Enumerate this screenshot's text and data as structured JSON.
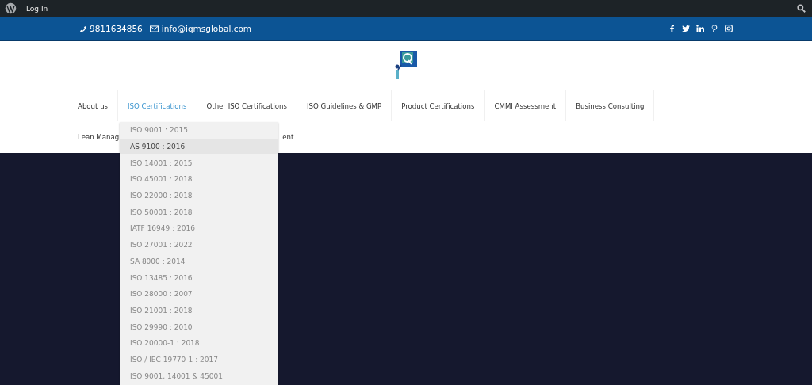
{
  "admin_bar": {
    "login": "Log In"
  },
  "top_bar": {
    "phone": "9811634856",
    "email": "info@iqmsglobal.com"
  },
  "nav": {
    "row_1": [
      {
        "label": "About us",
        "selected": false
      },
      {
        "label": "ISO Certifications",
        "selected": true
      },
      {
        "label": "Other ISO Certifications",
        "selected": false
      },
      {
        "label": "ISO Guidelines & GMP",
        "selected": false
      },
      {
        "label": "Product Certifications",
        "selected": false
      },
      {
        "label": "CMMI Assessment",
        "selected": false
      },
      {
        "label": "Business Consulting",
        "selected": false
      }
    ],
    "row_2": [
      "Lean Manag",
      "ent"
    ]
  },
  "dropdown": [
    {
      "label": "ISO 9001 : 2015",
      "selected": false
    },
    {
      "label": "AS 9100 : 2016",
      "selected": true
    },
    {
      "label": "ISO 14001 : 2015",
      "selected": false
    },
    {
      "label": "ISO 45001 : 2018",
      "selected": false
    },
    {
      "label": "ISO 22000 : 2018",
      "selected": false
    },
    {
      "label": "ISO 50001 : 2018",
      "selected": false
    },
    {
      "label": "IATF 16949 : 2016",
      "selected": false
    },
    {
      "label": "ISO 27001 : 2022",
      "selected": false
    },
    {
      "label": "SA 8000 : 2014",
      "selected": false
    },
    {
      "label": "ISO 13485 : 2016",
      "selected": false
    },
    {
      "label": "ISO 28000 : 2007",
      "selected": false
    },
    {
      "label": "ISO 21001 : 2018",
      "selected": false
    },
    {
      "label": "ISO 29990 : 2010",
      "selected": false
    },
    {
      "label": "ISO 20000-1 : 2018",
      "selected": false
    },
    {
      "label": "ISO / IEC 19770-1 : 2017",
      "selected": false
    },
    {
      "label": "ISO 9001, 14001 & 45001",
      "selected": false
    }
  ]
}
